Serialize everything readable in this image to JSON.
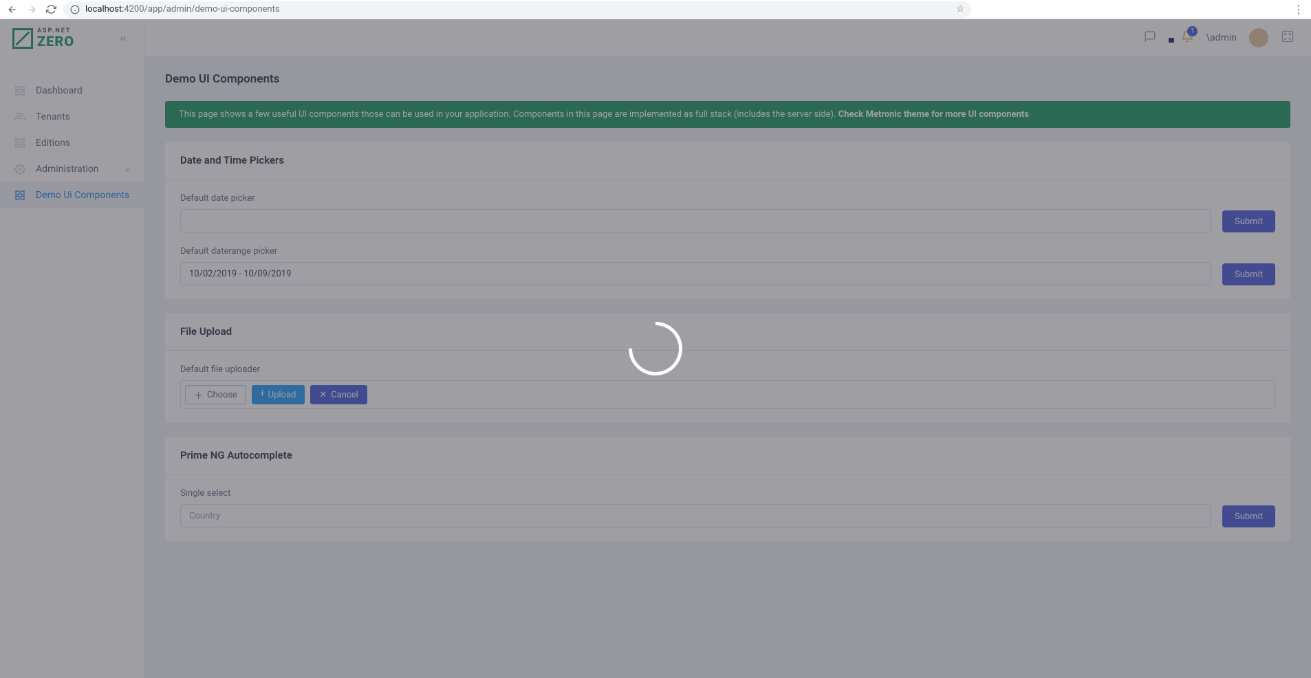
{
  "browser": {
    "url_host": "localhost:",
    "url_port_path": "4200/app/admin/demo-ui-components"
  },
  "logo": {
    "small": "ASP.NET",
    "big": "ZERO"
  },
  "sidebar": {
    "items": [
      {
        "label": "Dashboard"
      },
      {
        "label": "Tenants"
      },
      {
        "label": "Editions"
      },
      {
        "label": "Administration",
        "has_children": true
      },
      {
        "label": "Demo Ui Components",
        "active": true
      }
    ]
  },
  "topbar": {
    "notification_count": "1",
    "username": "\\admin"
  },
  "page": {
    "title": "Demo UI Components",
    "alert_text": "This page shows a few useful UI components those can be used in your application. Components in this page are implemented as full stack (includes the server side).",
    "alert_link": "Check Metronic theme for more UI components"
  },
  "sections": {
    "date": {
      "title": "Date and Time Pickers",
      "default_date_label": "Default date picker",
      "default_range_label": "Default daterange picker",
      "range_value": "10/02/2019 - 10/09/2019",
      "submit": "Submit"
    },
    "upload": {
      "title": "File Upload",
      "label": "Default file uploader",
      "choose": "Choose",
      "upload": "Upload",
      "cancel": "Cancel"
    },
    "autocomplete": {
      "title": "Prime NG Autocomplete",
      "single_label": "Single select",
      "placeholder": "Country",
      "submit": "Submit"
    }
  }
}
